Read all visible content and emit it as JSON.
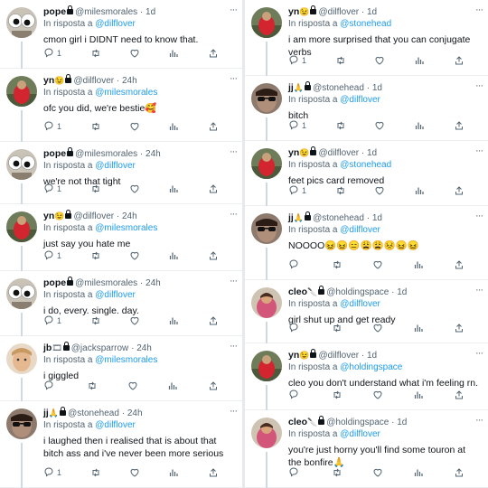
{
  "reply_prefix": "In risposta a",
  "more_label": "···",
  "left": [
    {
      "name": "pope",
      "emoji": "",
      "handle": "@milesmorales",
      "time": "1d",
      "reply_to": "@dilflover",
      "text": "cmon girl i DIDNT need to know that.",
      "replies": "1",
      "avatar": "eyes"
    },
    {
      "name": "yn",
      "emoji": "😉",
      "handle": "@dilflover",
      "time": "24h",
      "reply_to": "@milesmorales",
      "text": "ofc you did, we're bestie🥰",
      "replies": "1",
      "avatar": "red"
    },
    {
      "name": "pope",
      "emoji": "",
      "handle": "@milesmorales",
      "time": "24h",
      "reply_to": "@dilflover",
      "text": "we're not that tight",
      "replies": "1",
      "avatar": "eyes"
    },
    {
      "name": "yn",
      "emoji": "😉",
      "handle": "@dilflover",
      "time": "24h",
      "reply_to": "@milesmorales",
      "text": "just say you hate me",
      "replies": "1",
      "avatar": "red"
    },
    {
      "name": "pope",
      "emoji": "",
      "handle": "@milesmorales",
      "time": "24h",
      "reply_to": "@dilflover",
      "text": "i do, every. single. day.",
      "replies": "1",
      "avatar": "eyes"
    },
    {
      "name": "jb",
      "emoji": "🎞",
      "handle": "@jacksparrow",
      "time": "24h",
      "reply_to": "@milesmorales",
      "text": "i giggled",
      "replies": "",
      "avatar": "face"
    },
    {
      "name": "jj",
      "emoji": "🙏",
      "handle": "@stonehead",
      "time": "24h",
      "reply_to": "@dilflover",
      "text": "i laughed then i realised that is about that bitch ass and i've never been more serious",
      "replies": "1",
      "avatar": "shades"
    }
  ],
  "right": [
    {
      "name": "yn",
      "emoji": "😉",
      "handle": "@dilflover",
      "time": "1d",
      "reply_to": "@stonehead",
      "text": "i am more surprised that you can conjugate verbs",
      "replies": "1",
      "avatar": "red"
    },
    {
      "name": "jj",
      "emoji": "🙏",
      "handle": "@stonehead",
      "time": "1d",
      "reply_to": "@dilflover",
      "text": "bitch",
      "replies": "1",
      "avatar": "shades"
    },
    {
      "name": "yn",
      "emoji": "😉",
      "handle": "@dilflover",
      "time": "1d",
      "reply_to": "@stonehead",
      "text": "feet pics card removed",
      "replies": "1",
      "avatar": "red"
    },
    {
      "name": "jj",
      "emoji": "🙏",
      "handle": "@stonehead",
      "time": "1d",
      "reply_to": "@dilflover",
      "text": "NOOOO😖😖😑😩😩😣😖😖",
      "replies": "",
      "avatar": "shades"
    },
    {
      "name": "cleo",
      "emoji": "🔪",
      "handle": "@holdingspace",
      "time": "1d",
      "reply_to": "@dilflover",
      "text": "girl shut up and get ready",
      "replies": "",
      "avatar": "pink"
    },
    {
      "name": "yn",
      "emoji": "😉",
      "handle": "@dilflover",
      "time": "1d",
      "reply_to": "@holdingspace",
      "text": "cleo you don't understand what i'm feeling rn.",
      "replies": "",
      "avatar": "red"
    },
    {
      "name": "cleo",
      "emoji": "🔪",
      "handle": "@holdingspace",
      "time": "1d",
      "reply_to": "@dilflover",
      "text": "you're just horny you'll find some touron at the bonfire🙏",
      "replies": "",
      "avatar": "pink"
    }
  ]
}
